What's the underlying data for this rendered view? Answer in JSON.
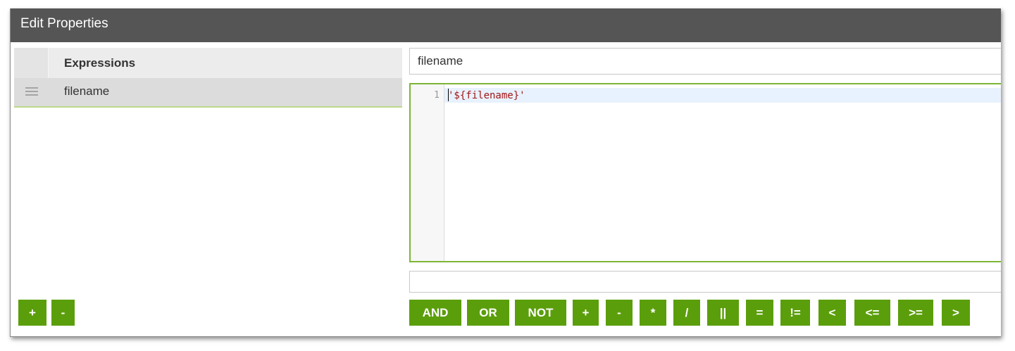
{
  "dialog": {
    "title": "Edit Properties"
  },
  "expressions": {
    "header": "Expressions",
    "rows": [
      {
        "label": "filename"
      }
    ],
    "add_label": "+",
    "remove_label": "-"
  },
  "editor": {
    "name_value": "filename",
    "line_number": "1",
    "code": "'${filename}'",
    "result_value": ""
  },
  "operators": [
    "AND",
    "OR",
    "NOT",
    "+",
    "-",
    "*",
    "/",
    "||",
    "=",
    "!=",
    "<",
    "<=",
    ">=",
    ">"
  ],
  "colors": {
    "title_bar": "#555555",
    "button_green": "#5b9e0b",
    "editor_border": "#7db536",
    "code_string": "#a31515"
  }
}
